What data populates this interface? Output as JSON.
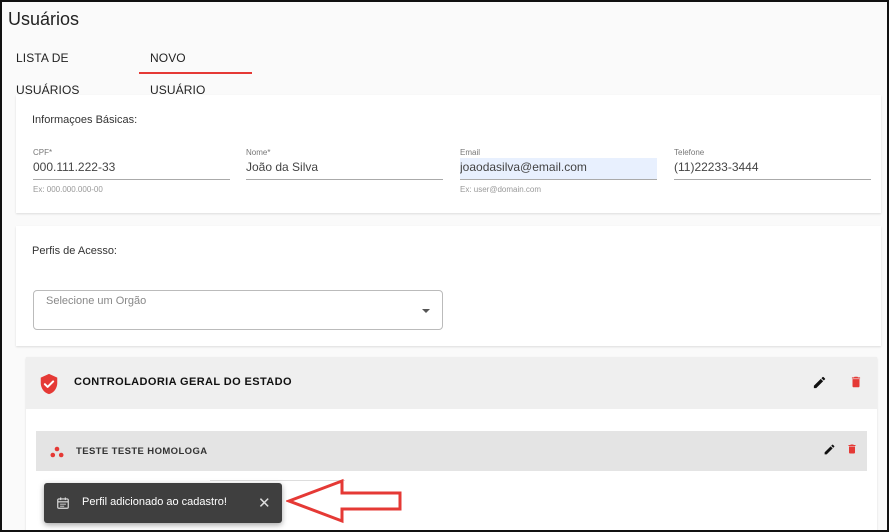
{
  "page": {
    "title": "Usuários"
  },
  "tabs": [
    {
      "label": "LISTA DE USUÁRIOS",
      "active": false
    },
    {
      "label": "NOVO USUÁRIO",
      "active": true
    }
  ],
  "basic_info": {
    "section_title": "Informaçoes Básicas:",
    "fields": [
      {
        "label": "CPF*",
        "value": "000.111.222-33",
        "hint": "Ex: 000.000.000-00"
      },
      {
        "label": "Nome*",
        "value": "João da Silva",
        "hint": ""
      },
      {
        "label": "Email",
        "value": "joaodasilva@email.com",
        "hint": "Ex: user@domain.com"
      },
      {
        "label": "Telefone",
        "value": "(11)22233-3444",
        "hint": ""
      }
    ]
  },
  "access_profiles": {
    "section_title": "Perfis de Acesso:",
    "select_placeholder": "Selecione um Orgão"
  },
  "org": {
    "title": "CONTROLADORIA GERAL DO ESTADO",
    "profile": {
      "title": "TESTE TESTE HOMOLOGA"
    }
  },
  "snackbar": {
    "message": "Perfil adicionado ao cadastro!",
    "close_symbol": "✕"
  },
  "colors": {
    "accent": "#e53935",
    "snackbar_bg": "#3f3f3f",
    "annotation_arrow": "#e53935"
  }
}
